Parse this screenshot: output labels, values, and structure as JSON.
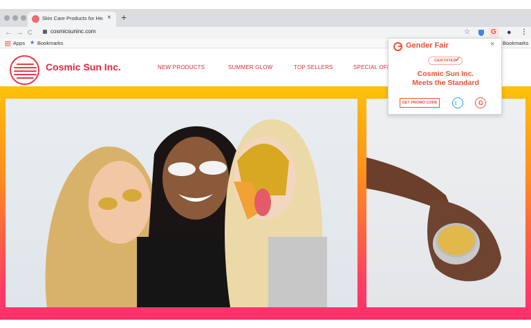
{
  "browser": {
    "tab_title": "Skin Care Products for Health",
    "tab_close": "×",
    "new_tab": "+",
    "back": "←",
    "forward": "→",
    "reload": "C",
    "url": "cosmicsuninc.com",
    "bookmark_star": "☆",
    "account_icon": "●",
    "menu_icon": "⋮",
    "bookmarks_bar": {
      "apps_label": "Apps",
      "bookmarks_label": "Bookmarks",
      "bookmarks_right_label": "Bookmarks"
    }
  },
  "site": {
    "brand": "Cosmic Sun Inc.",
    "nav": [
      "NEW PRODUCTS",
      "SUMMER GLOW",
      "TOP SELLERS",
      "SPECIAL OFF"
    ],
    "colors": {
      "accent": "#e5283d",
      "gradient_top": "#fec10a",
      "gradient_bottom": "#ff2f6e"
    }
  },
  "popup": {
    "name": "Gender Fair",
    "close": "×",
    "certified": "CERTIFIED",
    "check": "✔",
    "title_line1": "Cosmic Sun Inc.",
    "title_line2": "Meets the Standard",
    "promo_button": "GET PROMO CODE",
    "twitter_glyph": "t",
    "gf_glyph": "G",
    "accent": "#ef4f34"
  }
}
